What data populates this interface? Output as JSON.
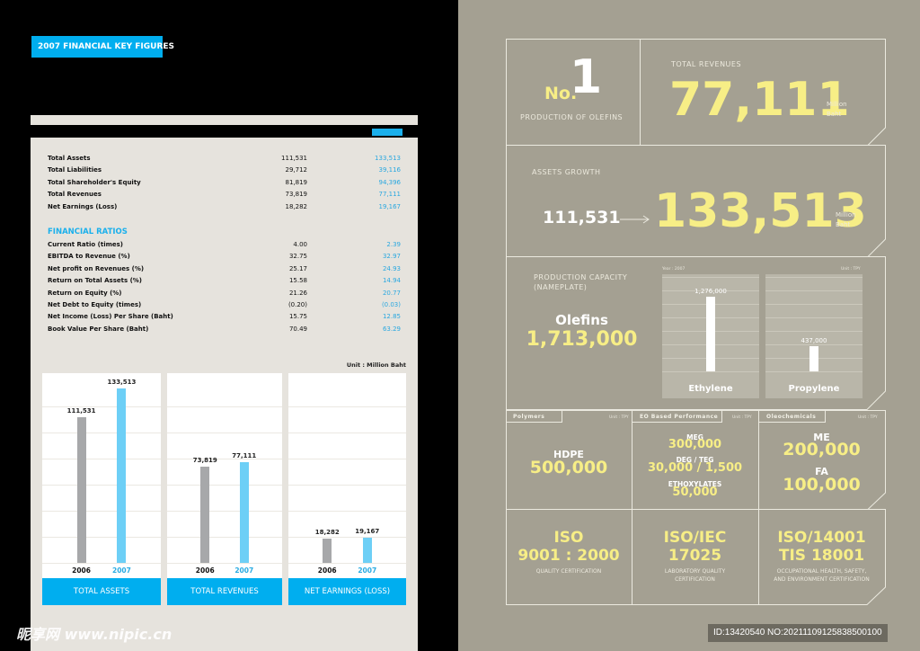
{
  "left_page": {
    "title_tag": "2007 FINANCIAL KEY FIGURES",
    "accent_color": "#00aeef",
    "key_figures": [
      {
        "label": "Total Assets",
        "y2006": "111,531",
        "y2007": "133,513"
      },
      {
        "label": "Total Liabilities",
        "y2006": "29,712",
        "y2007": "39,116"
      },
      {
        "label": "Total Shareholder's Equity",
        "y2006": "81,819",
        "y2007": "94,396"
      },
      {
        "label": "Total Revenues",
        "y2006": "73,819",
        "y2007": "77,111"
      },
      {
        "label": "Net Earnings (Loss)",
        "y2006": "18,282",
        "y2007": "19,167"
      }
    ],
    "ratios_heading": "FINANCIAL RATIOS",
    "ratios": [
      {
        "label": "Current Ratio (times)",
        "y2006": "4.00",
        "y2007": "2.39"
      },
      {
        "label": "EBITDA to Revenue (%)",
        "y2006": "32.75",
        "y2007": "32.97"
      },
      {
        "label": "Net profit on Revenues (%)",
        "y2006": "25.17",
        "y2007": "24.93"
      },
      {
        "label": "Return on Total Assets (%)",
        "y2006": "15.58",
        "y2007": "14.94"
      },
      {
        "label": "Return on Equity (%)",
        "y2006": "21.26",
        "y2007": "20.77"
      },
      {
        "label": "Net Debt to Equity (times)",
        "y2006": "(0.20)",
        "y2007": "(0.03)"
      },
      {
        "label": "Net Income (Loss) Per Share (Baht)",
        "y2006": "15.75",
        "y2007": "12.85"
      },
      {
        "label": "Book Value Per Share (Baht)",
        "y2006": "70.49",
        "y2007": "63.29"
      }
    ],
    "watermark": "昵享网 www.nipic.cn"
  },
  "chart_data": [
    {
      "type": "bar",
      "unit_label": "Unit : Million Baht",
      "categories": [
        "2006",
        "2007"
      ],
      "colors": {
        "2006": "#a7a8aa",
        "2007": "#6dcff6"
      },
      "panels": [
        {
          "title": "TOTAL ASSETS",
          "values": [
            111531,
            133513
          ],
          "labels": [
            "111,531",
            "133,513"
          ]
        },
        {
          "title": "TOTAL REVENUES",
          "values": [
            73819,
            77111
          ],
          "labels": [
            "73,819",
            "77,111"
          ]
        },
        {
          "title": "NET EARNINGS (LOSS)",
          "values": [
            18282,
            19167
          ],
          "labels": [
            "18,282",
            "19,167"
          ]
        }
      ],
      "ylim": [
        0,
        150000
      ],
      "grid": true
    },
    {
      "type": "bar",
      "year_label": "Year : 2007",
      "unit_label": "Unit : TPY",
      "categories": [
        "Ethylene",
        "Propylene"
      ],
      "values": [
        1276000,
        437000
      ],
      "labels": [
        "1,276,000",
        "437,000"
      ],
      "grid": true
    }
  ],
  "right_page": {
    "rank_prefix": "No.",
    "rank_number": "1",
    "rank_caption": "PRODUCTION OF OLEFINS",
    "revenues_caption": "TOTAL REVENUES",
    "revenues_value": "77,111",
    "unit_million": "Million",
    "unit_baht": "Baht",
    "assets_caption": "ASSETS GROWTH",
    "assets_from": "111,531",
    "assets_to": "133,513",
    "capacity_caption_1": "PRODUCTION CAPACITY",
    "capacity_caption_2": "(NAMEPLATE)",
    "olefins_label": "Olefins",
    "olefins_value": "1,713,000",
    "unit_tpy": "Unit : TPY",
    "polymers": {
      "tag": "Polymers",
      "name": "HDPE",
      "value": "500,000"
    },
    "eo": {
      "tag": "EO Based Performance",
      "items": [
        {
          "name": "MEG",
          "value": "300,000"
        },
        {
          "name": "DEG / TEG",
          "value": "30,000 / 1,500"
        },
        {
          "name": "ETHOXYLATES",
          "value": "50,000"
        }
      ]
    },
    "oleo": {
      "tag": "Oleochemicals",
      "items": [
        {
          "name": "ME",
          "value": "200,000"
        },
        {
          "name": "FA",
          "value": "100,000"
        }
      ]
    },
    "certs": [
      {
        "line1": "ISO",
        "line2": "9001 : 2000",
        "desc1": "QUALITY CERTIFICATION",
        "desc2": ""
      },
      {
        "line1": "ISO/IEC",
        "line2": "17025",
        "desc1": "LABORATORY QUALITY",
        "desc2": "CERTIFICATION"
      },
      {
        "line1": "ISO/14001",
        "line2": "TIS 18001",
        "desc1": "OCCUPATIONAL HEALTH, SAFETY,",
        "desc2": "AND ENVIRONMENT CERTIFICATION"
      }
    ],
    "highlight_color": "#f7ee86",
    "id_box": "ID:13420540 NO:20211109125838500100"
  }
}
